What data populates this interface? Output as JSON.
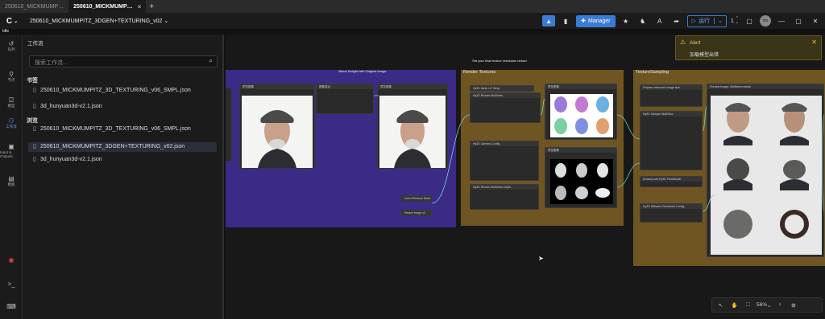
{
  "browser_tabs": [
    {
      "label": "250610_MICKMUMP…",
      "active": false
    },
    {
      "label": "250610_MICKMUMP…",
      "active": true
    }
  ],
  "menubar": {
    "workflow_title": "250610_MICKMUMPITZ_3DGEN+TEXTURING_v02",
    "manager_label": "Manager",
    "run_label": "运行",
    "queue_count": "1",
    "avatar_initials": "ms"
  },
  "status_text": "Idle",
  "iconbar": [
    {
      "icon": "history-icon",
      "label": "队列"
    },
    {
      "icon": "node-library-icon",
      "label": "节点"
    },
    {
      "icon": "model-library-icon",
      "label": "模型"
    },
    {
      "icon": "workflows-icon",
      "label": "工作流"
    },
    {
      "icon": "input-output-icon",
      "label": "Input & Outputs"
    },
    {
      "icon": "templates-icon",
      "label": "模板"
    }
  ],
  "sidepanel": {
    "title": "工作流",
    "search_placeholder": "搜索工作流…",
    "bookmarks_title": "书签",
    "bookmarks": [
      "250610_MICKMUMPITZ_3D_TEXTURING_v06_SMPL.json",
      "3d_hunyuan3d-v2.1.json"
    ],
    "browse_title": "浏览",
    "browse": [
      "250610_MICKMUMPITZ_3D_TEXTURING_v06_SMPL.json",
      "250610_MICKMUMPITZ_3DGEN+TEXTURING_v02.json",
      "3d_hunyuan3d-v2.1.json"
    ]
  },
  "canvas": {
    "notes": {
      "blend": "Blend Delight with Original Image",
      "texture_res": "Set your final texture resolution below!"
    },
    "groups": [
      {
        "title": "",
        "color": "#3b2a86"
      },
      {
        "title": "Render Textures",
        "color": "#6e5522"
      },
      {
        "title": "TextureSampling",
        "color": "#6e5522"
      }
    ],
    "node_titles": {
      "preview_1": "预览图像",
      "blend": "图像混合",
      "preview_2": "预览图像",
      "mesh_uv_wrap": "Hy3D Mesh UV Wrap",
      "render_multiview": "Hy3D Render MultiView",
      "camera_config": "Hy3D Camera Config",
      "render_depth": "Hy3D Render MultiView Depth",
      "preview_3": "预览图像",
      "preview_4": "预览图像",
      "prepare_ref": "Prepare reference image size",
      "sample_multiview": "Hy3D Sample MultiView",
      "preview_multiview": "Preview Image: Multiview results",
      "download_paint": "(Down)Load Hy3D PaintModel",
      "scheduler": "Hy3D Diffusers Scheduler Config",
      "invert": "Invert Remove Mesh",
      "resize": "Resize Image v2"
    }
  },
  "alert": {
    "title": "Alert",
    "message": "加载模型出错"
  },
  "bottom_tools": {
    "zoom": "56%"
  },
  "colors": {
    "accent": "#3a7bd5",
    "group_purple": "#3b2a86",
    "group_brown": "#6e5522",
    "alert_bg": "#3a3418"
  }
}
